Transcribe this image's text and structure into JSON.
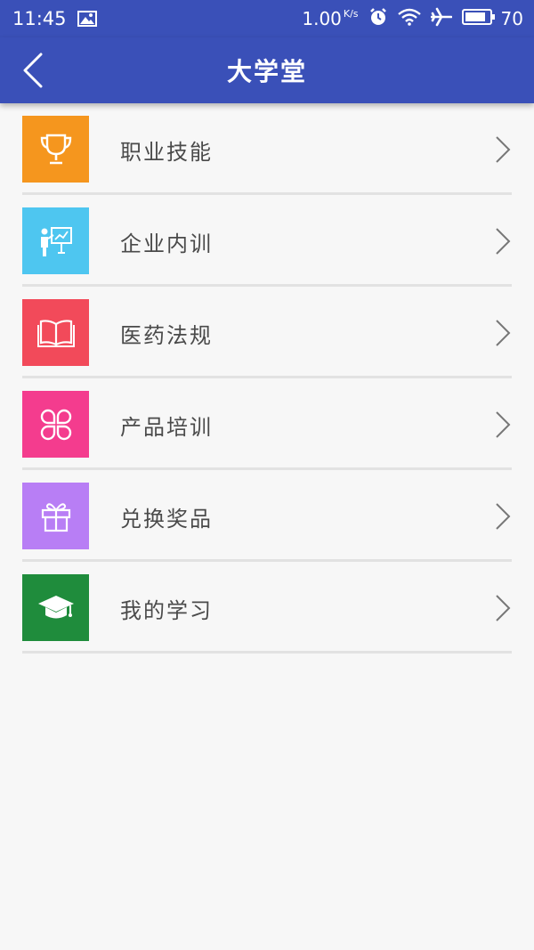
{
  "status_bar": {
    "time": "11:45",
    "speed_value": "1.00",
    "speed_unit": "K/s",
    "battery": "70",
    "icons": [
      "image-icon",
      "alarm-icon",
      "wifi-icon",
      "airplane-icon",
      "battery-icon"
    ]
  },
  "header": {
    "title": "大学堂",
    "background": "#3a50b8"
  },
  "menu": {
    "items": [
      {
        "label": "职业技能",
        "icon": "trophy-icon",
        "color": "#f5961e"
      },
      {
        "label": "企业内训",
        "icon": "presenter-icon",
        "color": "#4ec6f0"
      },
      {
        "label": "医药法规",
        "icon": "book-icon",
        "color": "#f24a5a"
      },
      {
        "label": "产品培训",
        "icon": "clover-icon",
        "color": "#f43c8e"
      },
      {
        "label": "兑换奖品",
        "icon": "gift-icon",
        "color": "#b87ef5"
      },
      {
        "label": "我的学习",
        "icon": "graduation-cap-icon",
        "color": "#1f8c3c"
      }
    ]
  }
}
